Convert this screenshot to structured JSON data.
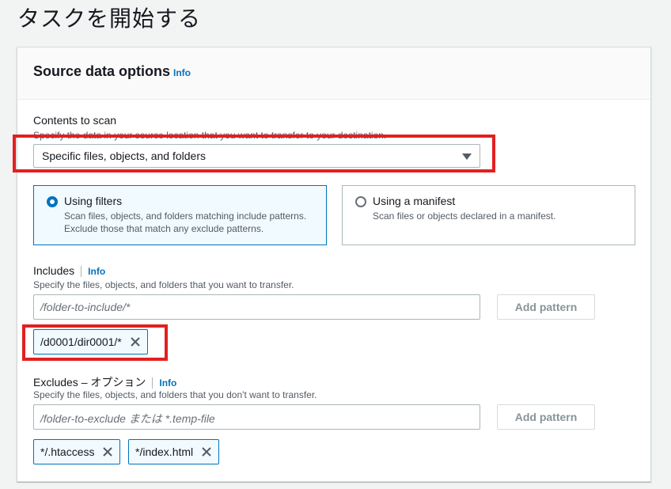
{
  "page": {
    "title": "タスクを開始する"
  },
  "panel": {
    "title": "Source data options",
    "info": "Info"
  },
  "contents_to_scan": {
    "label": "Contents to scan",
    "description": "Specify the data in your source location that you want to transfer to your destination.",
    "selected": "Specific files, objects, and folders"
  },
  "options": [
    {
      "title": "Using filters",
      "desc_line1": "Scan files, objects, and folders matching include patterns.",
      "desc_line2": "Exclude those that match any exclude patterns.",
      "checked": true
    },
    {
      "title": "Using a manifest",
      "desc_line1": "Scan files or objects declared in a manifest.",
      "checked": false
    }
  ],
  "includes": {
    "label": "Includes",
    "info": "Info",
    "description": "Specify the files, objects, and folders that you want to transfer.",
    "placeholder": "/folder-to-include/*",
    "button": "Add pattern",
    "tokens": [
      "/d0001/dir0001/*"
    ]
  },
  "excludes": {
    "label": "Excludes – オプション",
    "info": "Info",
    "description": "Specify the files, objects, and folders that you don't want to transfer.",
    "placeholder": "/folder-to-exclude または *.temp-file",
    "button": "Add pattern",
    "tokens": [
      "*/.htaccess",
      "*/index.html"
    ]
  },
  "colors": {
    "accent": "#0073bb",
    "highlight": "#e22020"
  }
}
